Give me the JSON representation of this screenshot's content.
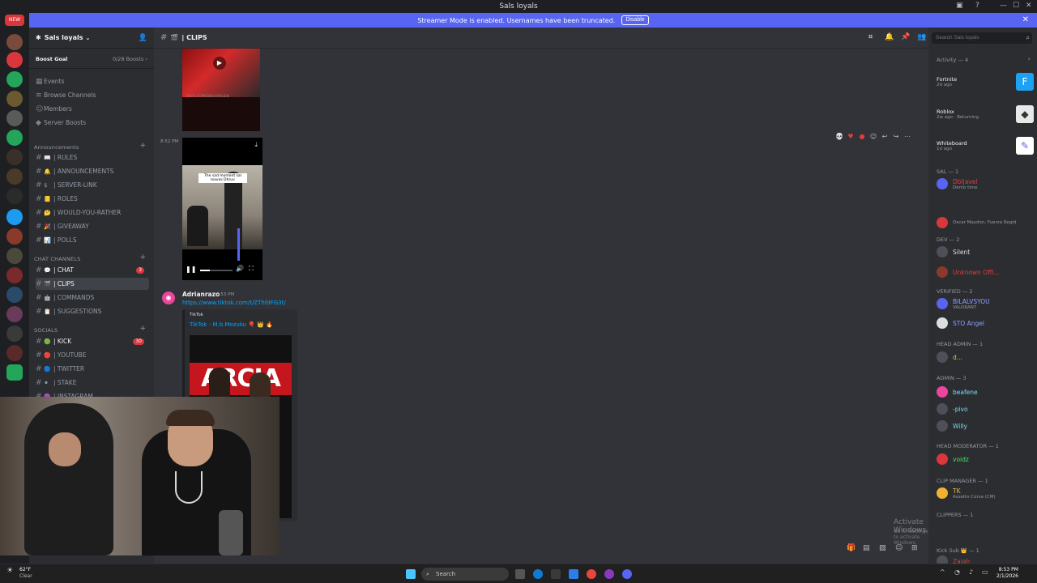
{
  "window": {
    "title": "Sals loyals",
    "new_badge": "NEW"
  },
  "banner": {
    "text": "Streamer Mode is enabled. Usernames have been truncated.",
    "button": "Disable"
  },
  "server": {
    "name": "Sals loyals",
    "boost_label": "Boost Goal",
    "boost_count": "0/28 Boosts"
  },
  "nav": [
    "Events",
    "Browse Channels",
    "Members",
    "Server Boosts"
  ],
  "categories": {
    "announcements": "Announcements",
    "chat": "CHAT CHANNELS",
    "socials": "SOCIALS"
  },
  "channels_announcements": [
    {
      "name": "| RULES",
      "emoji": "📖"
    },
    {
      "name": "| ANNOUNCEMENTS",
      "emoji": "🔔"
    },
    {
      "name": "| SERVER-LINK",
      "emoji": "$"
    },
    {
      "name": "| ROLES",
      "emoji": "📒"
    },
    {
      "name": "| WOULD-YOU-RATHER",
      "emoji": "🤔"
    },
    {
      "name": "| GIVEAWAY",
      "emoji": "🎉"
    },
    {
      "name": "| POLLS",
      "emoji": "📊"
    }
  ],
  "channels_chat": [
    {
      "name": "| CHAT",
      "emoji": "💬",
      "badge": "3"
    },
    {
      "name": "| CLIPS",
      "emoji": "🎬"
    },
    {
      "name": "| COMMANDS",
      "emoji": "🤖"
    },
    {
      "name": "| SUGGESTIONS",
      "emoji": "📋"
    }
  ],
  "channels_socials": [
    {
      "name": "| KICK",
      "emoji": "🟢",
      "badge": "30"
    },
    {
      "name": "| YOUTUBE",
      "emoji": "🔴"
    },
    {
      "name": "| TWITTER",
      "emoji": "🔵"
    },
    {
      "name": "| STAKE",
      "emoji": "⚫"
    },
    {
      "name": "| INSTAGRAM",
      "emoji": "🟣"
    }
  ],
  "header": {
    "channel": "| CLIPS",
    "search_placeholder": "Search Sals loyals"
  },
  "messages": {
    "time1": "8:52 PM",
    "video_caption": "The sad moment sal leaves Dhruv",
    "thumb_watermark": "KICK.COM/DBLIVIOGEN",
    "author2": "Adrianrazo",
    "time2": "8:53 PM",
    "link": "https://www.tiktok.com/t/ZThfdFG3t/",
    "embed_provider": "TikTok",
    "embed_title": "TikTok - M.b.Mozuku 🎈 👑 🔥",
    "embed_image_text": "ARCIA"
  },
  "activity": {
    "label": "Activity — 4",
    "items": [
      {
        "name": "Fortnite",
        "meta": "2d ago"
      },
      {
        "name": "Roblox",
        "meta": "2w ago · Returning"
      },
      {
        "name": "Whiteboard",
        "meta": "1d ago"
      }
    ]
  },
  "member_groups": [
    {
      "label": "SAL — 1"
    },
    {
      "label": "DEV — 2"
    },
    {
      "label": "VERIFIED — 2"
    },
    {
      "label": "HEAD ADMIN — 1"
    },
    {
      "label": "ADMIN — 3"
    },
    {
      "label": "HEAD MODERATOR — 1"
    },
    {
      "label": "CLIP MANAGER — 1"
    },
    {
      "label": "CLIPPERS — 1"
    },
    {
      "label": "Kick Sub 👑 — 1"
    }
  ],
  "members": [
    {
      "name": "Dbljavel",
      "status": "Demo time",
      "color": "#e23d3d"
    },
    {
      "name": "",
      "status": "Oscar Maydon, Fuerza Regid",
      "color": "#5865f2"
    },
    {
      "name": "Silent",
      "status": "",
      "color": "#dbdee1"
    },
    {
      "name": "Unknown Offi...",
      "status": "",
      "color": "#e23d3d"
    },
    {
      "name": "BILALVSYOU",
      "status": "VALORANT",
      "color": "#8fa1ff"
    },
    {
      "name": "STO Angel",
      "status": "",
      "color": "#8fa1ff"
    },
    {
      "name": "d...",
      "status": "",
      "color": "#e8c03b"
    },
    {
      "name": "beafene",
      "status": "",
      "color": "#7adcf2"
    },
    {
      "name": "-pivo",
      "status": "",
      "color": "#7adcf2"
    },
    {
      "name": "Willy",
      "status": "",
      "color": "#7adcf2"
    },
    {
      "name": "voidz",
      "status": "",
      "color": "#4ee26a"
    },
    {
      "name": "TK",
      "status": "Assetto Corsa (CM)",
      "color": "#e8c03b"
    },
    {
      "name": "Zaiah",
      "status": "",
      "color": "#e23d3d"
    }
  ],
  "watermark": {
    "line1": "Activate Windows",
    "line2": "Go to Settings to activate Windows."
  },
  "taskbar": {
    "weather_temp": "62°F",
    "weather_desc": "Clear",
    "search": "Search",
    "time": "8:53 PM",
    "date": "2/1/2026"
  }
}
